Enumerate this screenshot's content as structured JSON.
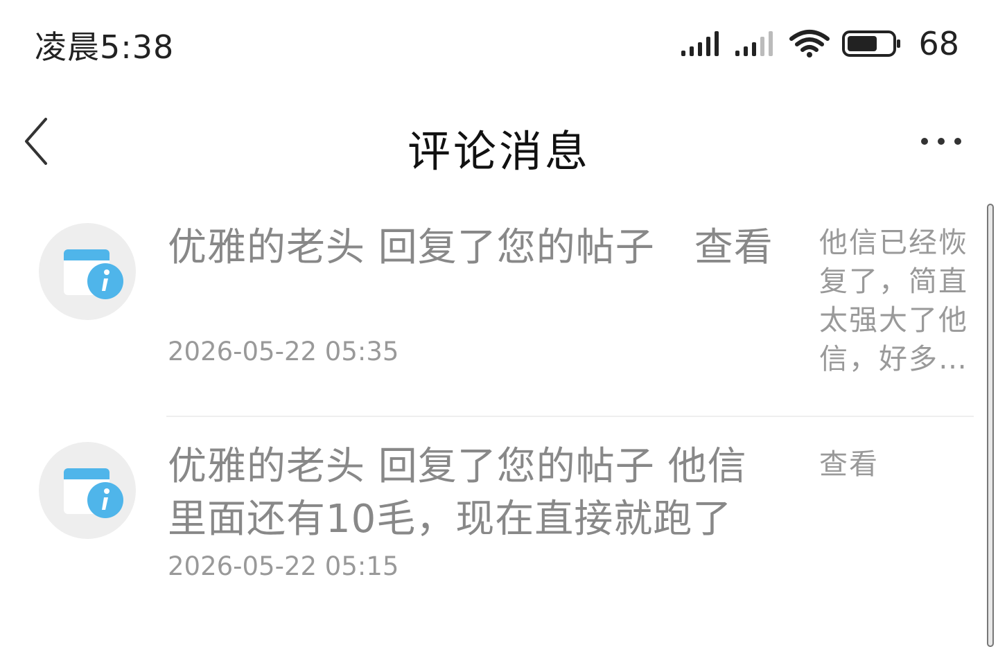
{
  "status_bar": {
    "time": "凌晨5:38",
    "battery_level": "68",
    "icons": [
      "signal-icon",
      "signal-icon",
      "wifi-icon",
      "battery-icon"
    ]
  },
  "header": {
    "title": "评论消息",
    "back_icon": "chevron-left-icon",
    "more_icon": "more-horizontal-icon"
  },
  "messages": [
    {
      "icon": "notification-info-icon",
      "text": "优雅的老头 回复了您的帖子　查看",
      "time": "2026-05-22 05:35",
      "preview": "他信已经恢复了，简直太强大了他信，好多…"
    },
    {
      "icon": "notification-info-icon",
      "text": "优雅的老头 回复了您的帖子 他信里面还有10毛，现在直接就跑了",
      "time": "2026-05-22 05:15",
      "preview": "查看"
    }
  ],
  "colors": {
    "background": "#ffffff",
    "text_primary": "#222222",
    "text_secondary": "#888888",
    "avatar_bg": "#eeeeee",
    "accent_blue": "#4fb5ea"
  }
}
